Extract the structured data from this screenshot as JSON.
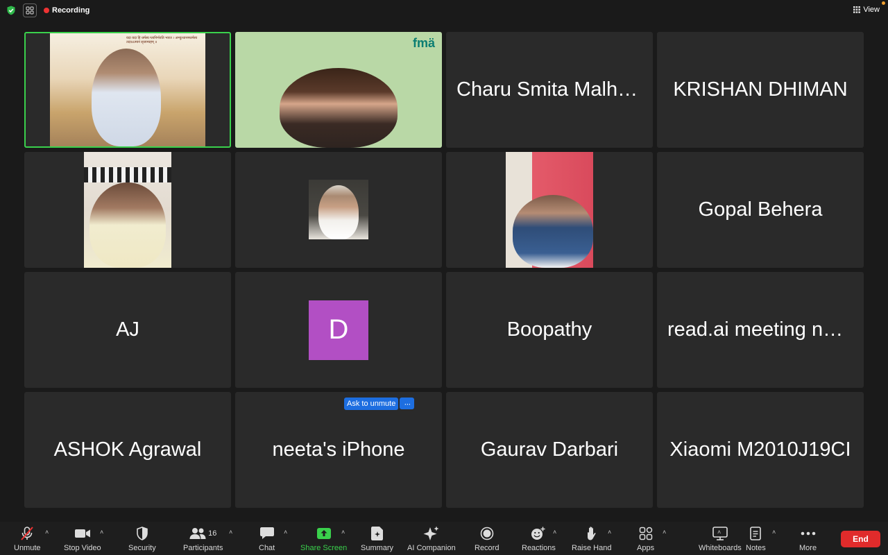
{
  "topbar": {
    "recording": "Recording",
    "view": "View"
  },
  "tiles": [
    {
      "type": "video",
      "id": "speaker-1",
      "caption": "यदा यदा हि धर्मस्य ग्लानिर्भवति भारत । अभ्युत्थानमधर्मस्य तदाऽऽत्मानं सृजाम्यहम् ॥"
    },
    {
      "type": "video",
      "id": "speaker-2",
      "logo": "fmä"
    },
    {
      "type": "name",
      "name": "Charu Smita Malho…"
    },
    {
      "type": "name",
      "name": "KRISHAN DHIMAN"
    },
    {
      "type": "video",
      "id": "speaker-5"
    },
    {
      "type": "video",
      "id": "speaker-6"
    },
    {
      "type": "video",
      "id": "speaker-7"
    },
    {
      "type": "name",
      "name": "Gopal Behera"
    },
    {
      "type": "name",
      "name": "AJ"
    },
    {
      "type": "avatar",
      "letter": "D"
    },
    {
      "type": "name",
      "name": "Boopathy"
    },
    {
      "type": "name",
      "name": "read.ai meeting not…"
    },
    {
      "type": "name",
      "name": "ASHOK Agrawal"
    },
    {
      "type": "name",
      "name": "neeta's iPhone"
    },
    {
      "type": "name",
      "name": "Gaurav Darbari"
    },
    {
      "type": "name",
      "name": "Xiaomi M2010J19CI"
    }
  ],
  "ask_unmute": {
    "label": "Ask to unmute",
    "more": "···"
  },
  "toolbar": {
    "unmute": "Unmute",
    "stop_video": "Stop Video",
    "security": "Security",
    "participants": "Participants",
    "participants_count": "16",
    "chat": "Chat",
    "share_screen": "Share Screen",
    "summary": "Summary",
    "ai_companion": "AI Companion",
    "record": "Record",
    "reactions": "Reactions",
    "raise_hand": "Raise Hand",
    "apps": "Apps",
    "whiteboards": "Whiteboards",
    "notes": "Notes",
    "more": "More",
    "end": "End"
  },
  "colors": {
    "active_border": "#3ad14c",
    "share_green": "#3ad14c",
    "end_red": "#e02b2b",
    "ask_blue": "#1d6ee0",
    "avatar_purple": "#b24fc4"
  }
}
